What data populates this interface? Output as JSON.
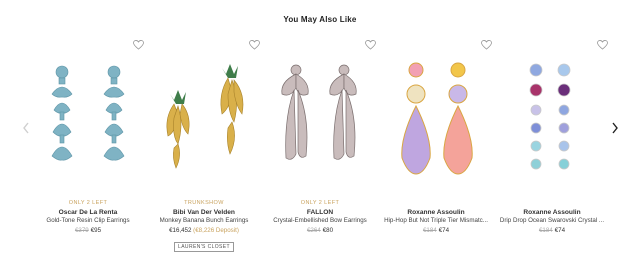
{
  "section_title": "You May Also Like",
  "products": [
    {
      "badge": "ONLY 2 LEFT",
      "designer": "Oscar De La Renta",
      "name": "Gold-Tone Resin Clip Earrings",
      "old_price": "€379",
      "price": "€95",
      "deposit": "",
      "tag": ""
    },
    {
      "badge": "TRUNKSHOW",
      "designer": "Bibi Van Der Velden",
      "name": "Monkey Banana Bunch Earrings",
      "old_price": "",
      "price": "€16,452",
      "deposit": "(€8,226 Deposit)",
      "tag": "LAUREN'S CLOSET"
    },
    {
      "badge": "ONLY 2 LEFT",
      "designer": "FALLON",
      "name": "Crystal-Embellished Bow Earrings",
      "old_price": "€264",
      "price": "€80",
      "deposit": "",
      "tag": ""
    },
    {
      "badge": "",
      "designer": "Roxanne Assoulin",
      "name": "Hip-Hop But Not Triple Tier Mismatc...",
      "old_price": "€184",
      "price": "€74",
      "deposit": "",
      "tag": ""
    },
    {
      "badge": "",
      "designer": "Roxanne Assoulin",
      "name": "Drip Drop Ocean Swarovski Crystal ...",
      "old_price": "€184",
      "price": "€74",
      "deposit": "",
      "tag": ""
    }
  ]
}
